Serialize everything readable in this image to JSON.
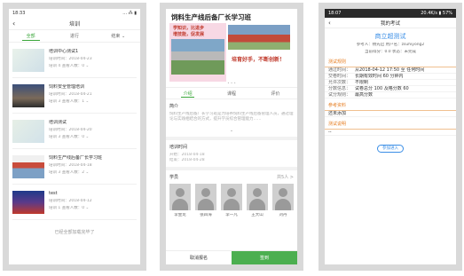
{
  "screen1": {
    "status_time": "18:33",
    "status_right": "... ⁂ ▮",
    "title": "培训",
    "tabs": [
      {
        "label": "全部",
        "active": true
      },
      {
        "label": "进行",
        "active": false
      },
      {
        "label": "结束 ⌄",
        "active": false
      }
    ],
    "items": [
      {
        "title": "培训中心测试1",
        "line1": "培训时间：2018-04-23",
        "line2": "培训 4  查看人数：0  ⌄"
      },
      {
        "title": "饲料安全管理培训",
        "line1": "培训时间：2018-04-21",
        "line2": "培训 3  查看人数：1  ⌄"
      },
      {
        "title": "培训测试",
        "line1": "培训时间：2018-04-20",
        "line2": "培训 3  查看人数：0  ⌄"
      },
      {
        "title": "饲料生产线后备厂长学习班",
        "line1": "培训时间：2018-04-18",
        "line2": "培训 3  查看人数：2  ⌄"
      },
      {
        "title": "test",
        "line1": "培训时间：2018-04-12",
        "line2": "培训 1  查看人数：0  ⌄"
      }
    ],
    "end_text": "已经全部加载完毕了"
  },
  "screen2": {
    "banner_title": "饲料生产线后备厂长学习班",
    "banner_red1": "学知识，比进步",
    "banner_red2": "增技能，促发展",
    "banner_slogan": "培育好手，不断创新！",
    "dots": "• • •",
    "tabs": [
      {
        "label": "介绍",
        "active": true
      },
      {
        "label": "课程",
        "active": false
      },
      {
        "label": "评价",
        "active": false
      }
    ],
    "intro_heading": "简介",
    "intro_text": "饲料生产线后备厂长学习班是为培养饲料生产线后备管理人员，通过理论与实践相结合的方式，提升学员综合管理能力……",
    "chevron": "⌄",
    "time_heading": "培训时间",
    "time_line1": "开始：2018-04-18",
    "time_line2": "结束：2018-04-28",
    "members_heading": "学员",
    "members_count": "共5人 >",
    "members": [
      "李金龙",
      "张四海",
      "李一凡",
      "王大山",
      "刘丹"
    ],
    "btn_left": "取消报名",
    "btn_right": "签到",
    "colors": {
      "accent": "#4caf50"
    }
  },
  "screen3": {
    "status_time": "18:07",
    "status_right": "20.4K/s ▮ 57%",
    "title": "我的考试",
    "exam_name": "商立超测试",
    "line1": "参考人：杨先启    用户名：zsuhiyong2",
    "line2": "当前得分：0.0    状态：未完成",
    "section_rules": "测试规则",
    "rows": [
      {
        "k": "通过时间：",
        "v": "从2018-04-12 17:50 至 任何时间"
      },
      {
        "k": "交卷时间：",
        "v": "长期有效时间 60 分钟内"
      },
      {
        "k": "允许次数：",
        "v": "不限制"
      },
      {
        "k": "分数信息：",
        "v": "试卷总分 100    及格分数 60"
      },
      {
        "k": "试分规则：",
        "v": "最高分数"
      }
    ],
    "section_ref": "参考资料",
    "ref_text": "还未添加",
    "section_desc": "测试说明",
    "desc_text": "--",
    "start_button": "参加进入",
    "colors": {
      "accent": "#3a8ee6",
      "section": "#e67e22"
    }
  }
}
